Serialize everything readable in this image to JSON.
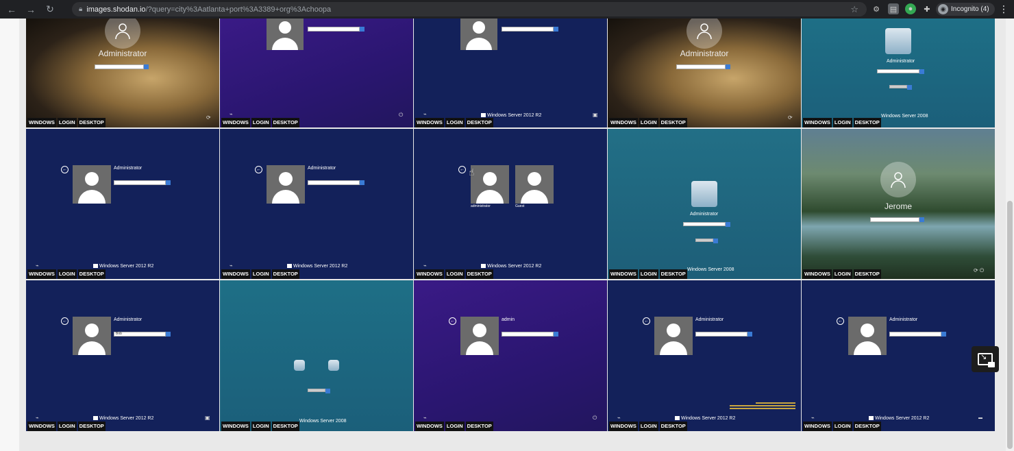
{
  "browser": {
    "url_host": "images.shodan.io",
    "url_path": "/?query=city%3Aatlanta+port%3A3389+org%3Achoopa",
    "incognito_label": "Incognito (4)"
  },
  "tile_labels": {
    "a": "WINDOWS",
    "b": "LOGIN",
    "c": "DESKTOP"
  },
  "tiles": {
    "t1": {
      "user": "Administrator"
    },
    "t4": {
      "user": "Administrator"
    },
    "t5": {
      "user": "Administrator",
      "footer": "Windows Server 2008"
    },
    "t3": {
      "footer": "Windows Server 2012 R2"
    },
    "t6": {
      "user": "Administrator",
      "footer": "Windows Server 2012 R2"
    },
    "t7": {
      "user": "Administrator",
      "footer": "Windows Server 2012 R2"
    },
    "t8": {
      "user1": "administrator",
      "user2": "Guest",
      "footer": "Windows Server 2012 R2"
    },
    "t9": {
      "user": "Administrator",
      "footer": "Windows Server 2008"
    },
    "t10": {
      "user": "Jerome"
    },
    "t11": {
      "user": "Administrator",
      "field": "Bob",
      "footer": "Windows Server 2012 R2"
    },
    "t12": {
      "footer": "Windows Server 2008"
    },
    "t13": {
      "user": "admin"
    },
    "t14": {
      "user": "Administrator",
      "footer": "Windows Server 2012 R2"
    },
    "t15": {
      "user": "Administrator",
      "footer": "Windows Server 2012 R2"
    }
  }
}
